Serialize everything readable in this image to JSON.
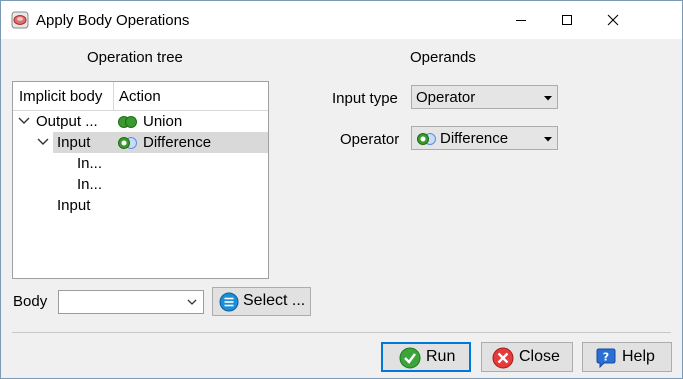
{
  "window": {
    "title": "Apply Body Operations"
  },
  "operation_tree": {
    "label": "Operation tree",
    "columns": [
      "Implicit body",
      "Action"
    ],
    "rows": [
      {
        "name": "Output ...",
        "action": "Union",
        "action_icon": "union-icon",
        "expanded": true
      },
      {
        "name": "Input",
        "action": "Difference",
        "action_icon": "difference-icon",
        "expanded": true,
        "selected": true
      },
      {
        "name": "In..."
      },
      {
        "name": "In..."
      },
      {
        "name": "Input"
      }
    ]
  },
  "body": {
    "label": "Body",
    "value": "",
    "select_button": "Select ..."
  },
  "operands": {
    "label": "Operands",
    "input_type": {
      "label": "Input type",
      "value": "Operator"
    },
    "operator": {
      "label": "Operator",
      "value": "Difference",
      "icon": "difference-icon"
    }
  },
  "buttons": {
    "run": "Run",
    "close": "Close",
    "help": "Help"
  },
  "colors": {
    "selection": "#d9d9d9",
    "union_green": "#3a9a2e",
    "difference_blue": "#5a8ee0",
    "run_border": "#0078d7"
  }
}
